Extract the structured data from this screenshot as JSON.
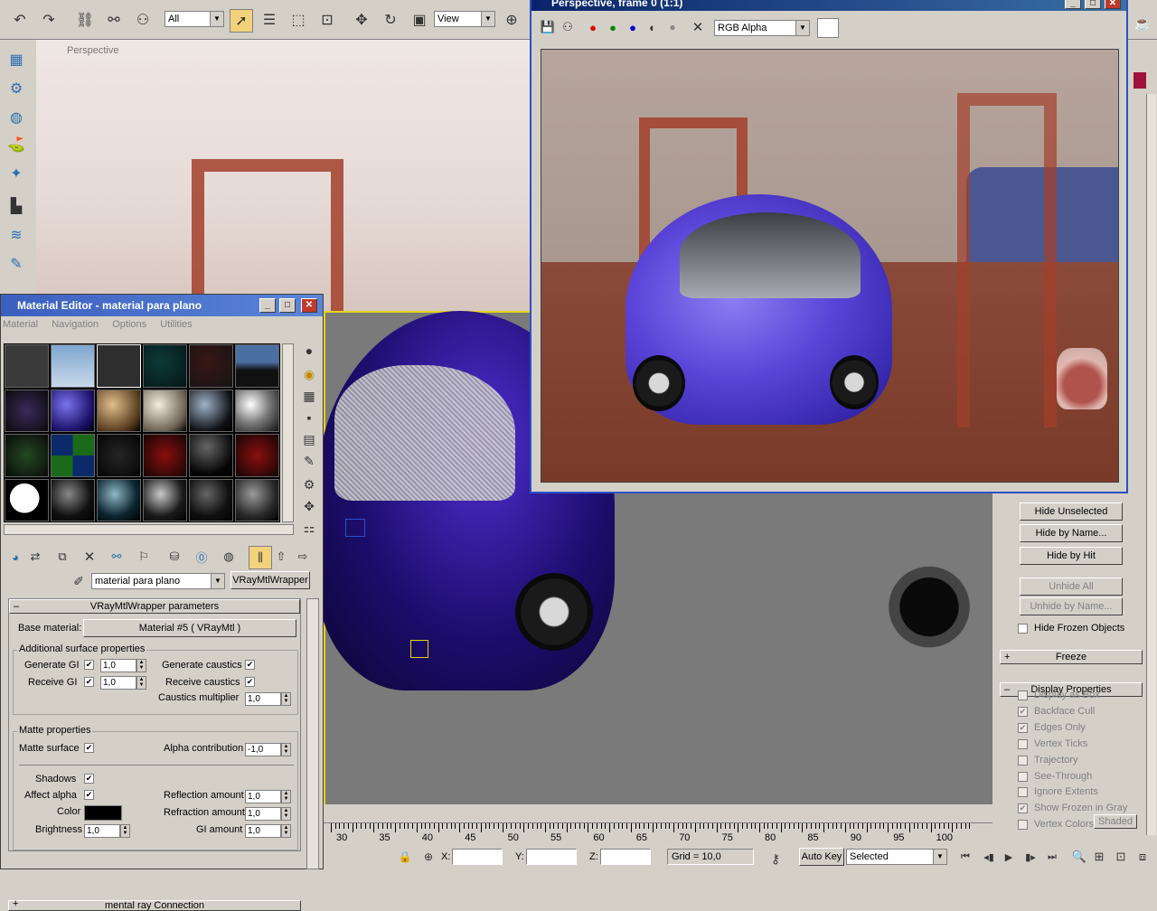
{
  "top_toolbar": {
    "selection_filter": "All",
    "reference_coord": "View"
  },
  "viewport": {
    "label": "Perspective"
  },
  "material_editor": {
    "title": "Material Editor - material para plano",
    "menu": [
      "Material",
      "Navigation",
      "Options",
      "Utilities"
    ],
    "material_name": "material para plano",
    "material_type": "VRayMtlWrapper",
    "rollout_title": "VRayMtlWrapper parameters",
    "base_material_label": "Base material:",
    "base_material_value": "Material #5  ( VRayMtl )",
    "additional_group": "Additional surface properties",
    "generate_gi": "Generate GI",
    "generate_gi_value": "1,0",
    "receive_gi": "Receive GI",
    "receive_gi_value": "1,0",
    "generate_caustics": "Generate caustics",
    "receive_caustics": "Receive caustics",
    "caustics_multiplier": "Caustics multiplier",
    "caustics_multiplier_value": "1,0",
    "matte_group": "Matte properties",
    "matte_surface": "Matte surface",
    "alpha_contribution": "Alpha contribution",
    "alpha_contribution_value": "-1,0",
    "shadows": "Shadows",
    "affect_alpha": "Affect alpha",
    "color": "Color",
    "brightness": "Brightness",
    "brightness_value": "1,0",
    "reflection_amount": "Reflection amount",
    "reflection_amount_value": "1,0",
    "refraction_amount": "Refraction amount",
    "refraction_amount_value": "1,0",
    "gi_amount": "GI amount",
    "gi_amount_value": "1,0",
    "bottom_rollout": "mental ray Connection"
  },
  "frame_window": {
    "title": "Perspective, frame 0 (1:1)",
    "channel": "RGB Alpha"
  },
  "right_panel": {
    "hide_unselected": "Hide Unselected",
    "hide_by_name": "Hide by Name...",
    "hide_by_hit": "Hide by Hit",
    "unhide_all": "Unhide All",
    "unhide_by_name": "Unhide by Name...",
    "hide_frozen": "Hide Frozen Objects",
    "freeze": "Freeze",
    "display_properties": "Display Properties",
    "options": [
      {
        "label": "Display as Box",
        "checked": false
      },
      {
        "label": "Backface Cull",
        "checked": true
      },
      {
        "label": "Edges Only",
        "checked": true
      },
      {
        "label": "Vertex Ticks",
        "checked": false
      },
      {
        "label": "Trajectory",
        "checked": false
      },
      {
        "label": "See-Through",
        "checked": false
      },
      {
        "label": "Ignore Extents",
        "checked": false
      },
      {
        "label": "Show Frozen in Gray",
        "checked": true
      },
      {
        "label": "Vertex Colors",
        "checked": false
      }
    ],
    "shaded": "Shaded"
  },
  "status_bar": {
    "ruler": [
      "30",
      "35",
      "40",
      "45",
      "50",
      "55",
      "60",
      "65",
      "70",
      "75",
      "80",
      "85",
      "90",
      "95",
      "100"
    ],
    "x_label": "X:",
    "y_label": "Y:",
    "z_label": "Z:",
    "grid": "Grid = 10,0",
    "auto_key": "Auto Key",
    "key_filter": "Selected"
  }
}
